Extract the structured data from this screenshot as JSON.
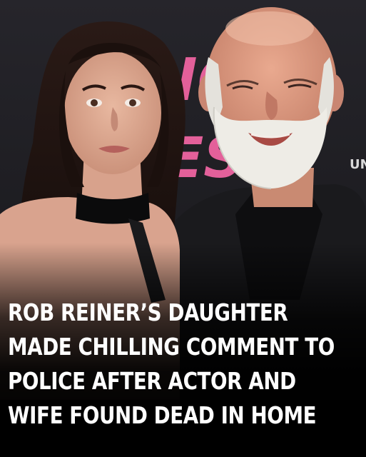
{
  "backdrop_text": {
    "sign_letters": "NG",
    "sign_letters_2": "ES",
    "right_edge_text": "UN"
  },
  "headline": {
    "lines": [
      "ROB REINER’S DAUGHTER",
      "MADE CHILLING COMMENT TO",
      "POLICE AFTER ACTOR AND",
      "WIFE FOUND DEAD IN HOME"
    ]
  },
  "colors": {
    "backdrop": "#1e1e22",
    "sign_pink": "#e3609a",
    "headline_text": "#ffffff",
    "caption_band": "#000000"
  }
}
